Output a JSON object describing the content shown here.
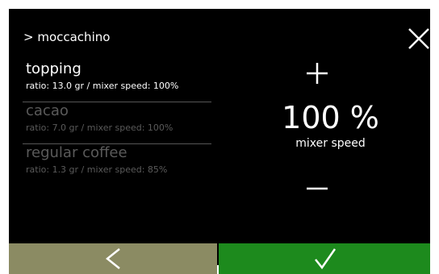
{
  "header": {
    "breadcrumb": "> moccachino",
    "close_icon": "close-icon"
  },
  "ingredients": [
    {
      "name": "topping",
      "detail": "ratio: 13.0 gr / mixer speed: 100%",
      "state": "selected"
    },
    {
      "name": "cacao",
      "detail": "ratio: 7.0 gr / mixer speed: 100%",
      "state": "unselected"
    },
    {
      "name": "regular coffee",
      "detail": "ratio: 1.3 gr / mixer speed: 85%",
      "state": "unselected"
    }
  ],
  "adjuster": {
    "increase_icon": "plus-icon",
    "value": "100 %",
    "label": "mixer speed",
    "decrease_icon": "minus-icon"
  },
  "footer": {
    "back_icon": "chevron-left-icon",
    "confirm_icon": "checkmark-icon"
  },
  "colors": {
    "background": "#000000",
    "back_button": "#8b8b63",
    "confirm_button": "#1d8a1d",
    "inactive_text": "#5a5a5a"
  }
}
